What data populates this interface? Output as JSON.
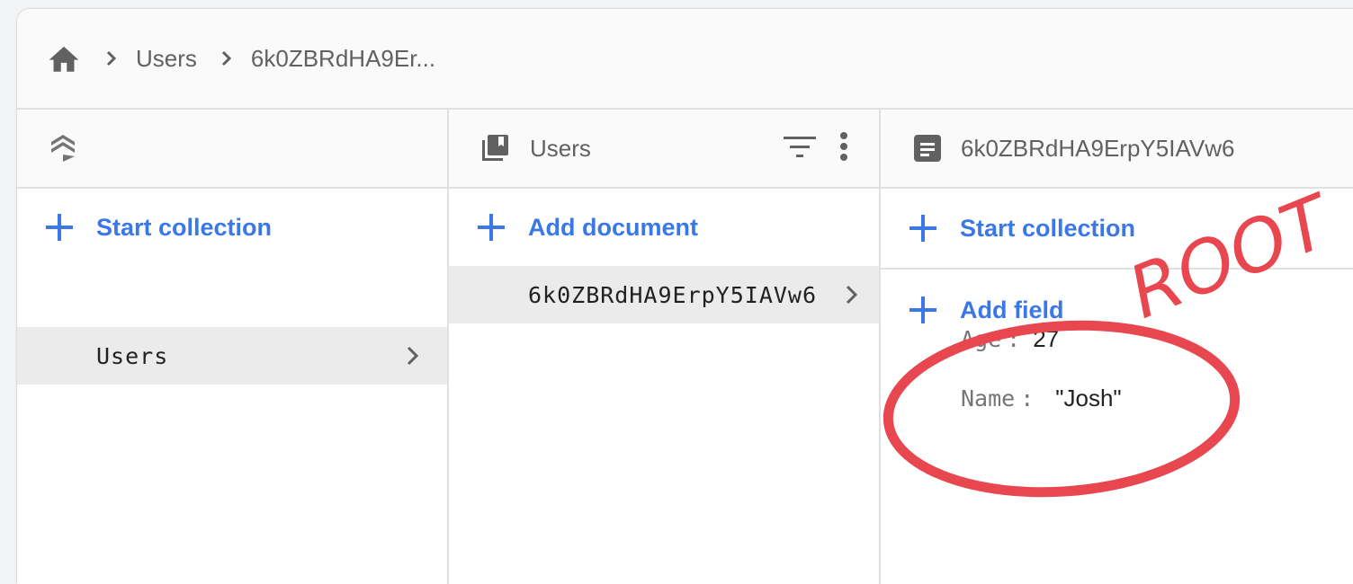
{
  "breadcrumb": {
    "home_icon": "home-icon",
    "items": [
      "Users",
      "6k0ZBRdHA9Er..."
    ]
  },
  "columns": {
    "root": {
      "icon": "firestore-stack-icon",
      "action_label": "Start collection",
      "items": [
        {
          "label": "Users",
          "selected": true
        }
      ]
    },
    "collection": {
      "icon": "collection-icon",
      "title": "Users",
      "filter_icon": "filter-icon",
      "more_icon": "more-vert-icon",
      "action_label": "Add document",
      "items": [
        {
          "label": "6k0ZBRdHA9ErpY5IAVw6",
          "selected": true
        }
      ]
    },
    "document": {
      "icon": "document-icon",
      "title": "6k0ZBRdHA9ErpY5IAVw6",
      "start_collection_label": "Start collection",
      "add_field_label": "Add field",
      "fields": [
        {
          "key": "Age",
          "sep": ":",
          "value": "27"
        },
        {
          "key": "Name",
          "sep": ":",
          "value": "\"Josh\""
        }
      ]
    }
  },
  "annotation": {
    "text": "ROOT",
    "color": "#e8474f"
  },
  "colors": {
    "accent": "#3b78e7",
    "selected_row": "#ebebeb"
  }
}
